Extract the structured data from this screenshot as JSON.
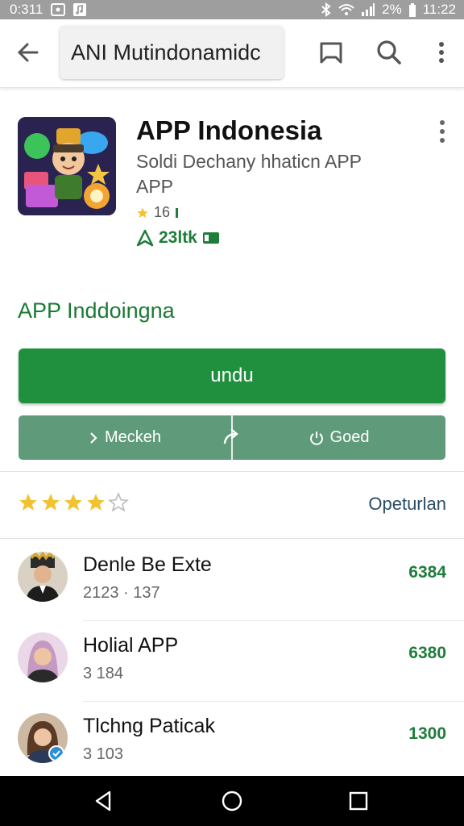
{
  "status_bar": {
    "left_text": "0:311",
    "battery_text": "2%",
    "time": "11:22"
  },
  "toolbar": {
    "search_value": "ANI Mutindonamidc"
  },
  "app": {
    "title": "APP Indonesia",
    "subtitle": "Soldi Dechany hhaticn APP APP",
    "rating": "16",
    "downloads": "23ltk"
  },
  "section": {
    "title": "APP Inddoingna"
  },
  "buttons": {
    "install_label": "undu",
    "left_label": "Meckeh",
    "right_label": "Goed"
  },
  "reviews": {
    "stars_filled": 4,
    "stars_total": 5,
    "see_all_label": "Opeturlan"
  },
  "list": [
    {
      "title": "Denle Be Exte",
      "subtitle": "2123 · 137",
      "value": "6384"
    },
    {
      "title": "Holial  APP",
      "subtitle": "3 184",
      "value": "6380"
    },
    {
      "title": "Tlchng Paticak",
      "subtitle": "3 103",
      "value": "1300"
    }
  ],
  "colors": {
    "accent_green": "#20903f",
    "secondary_green": "#5f9b7a",
    "status_bar": "#9e9e9e"
  }
}
